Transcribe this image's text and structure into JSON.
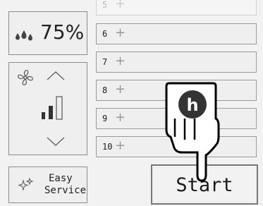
{
  "humidity": {
    "value_label": "75%",
    "icon": "water-drops-icon"
  },
  "fan": {
    "icon": "fan-icon",
    "up_icon": "chevron-up-icon",
    "down_icon": "chevron-down-icon",
    "level_icon": "signal-bars-icon",
    "level_bars_filled": 2,
    "level_bars_total": 3
  },
  "easy_service": {
    "line1": "Easy",
    "line2": "Service",
    "icon": "sparkle-icon"
  },
  "rows": [
    {
      "num": "5",
      "icon": "plus-icon"
    },
    {
      "num": "6",
      "icon": "plus-icon"
    },
    {
      "num": "7",
      "icon": "plus-icon"
    },
    {
      "num": "8",
      "icon": "plus-icon"
    },
    {
      "num": "9",
      "icon": "plus-icon"
    },
    {
      "num": "10",
      "icon": "plus-icon"
    }
  ],
  "start_button": {
    "label": "Start"
  },
  "hand_logo": {
    "letter": "h"
  },
  "colors": {
    "background": "#f2f2f2",
    "border": "#8c8c8c",
    "text": "#222222",
    "logo": "#333333"
  }
}
